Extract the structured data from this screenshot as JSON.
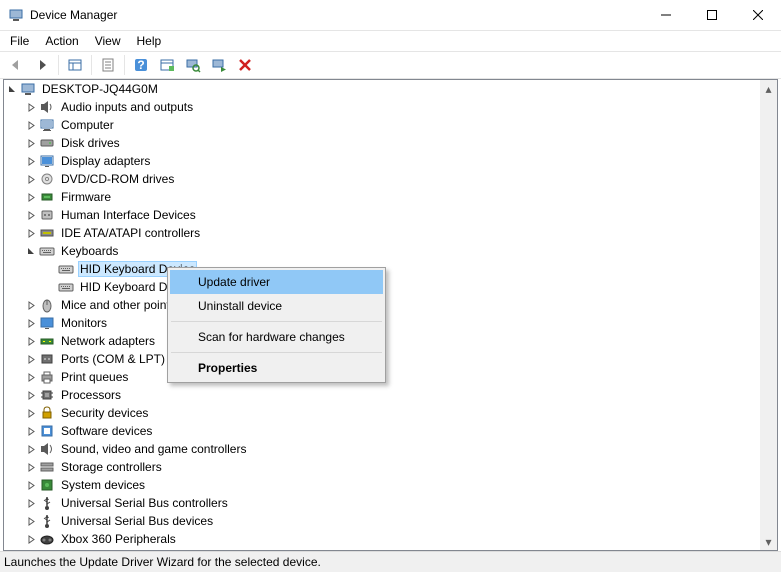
{
  "window": {
    "title": "Device Manager"
  },
  "menubar": {
    "items": [
      "File",
      "Action",
      "View",
      "Help"
    ]
  },
  "toolbar": {
    "items": [
      {
        "name": "back-icon",
        "sep_after": false
      },
      {
        "name": "forward-icon",
        "sep_after": true
      },
      {
        "name": "show-hidden-icon",
        "sep_after": true
      },
      {
        "name": "properties-icon",
        "sep_after": true
      },
      {
        "name": "help-icon",
        "sep_after": false
      },
      {
        "name": "update-driver-icon",
        "sep_after": false
      },
      {
        "name": "scan-hardware-icon",
        "sep_after": false
      },
      {
        "name": "enable-device-icon",
        "sep_after": false
      },
      {
        "name": "uninstall-device-icon",
        "sep_after": false
      }
    ]
  },
  "tree": {
    "root": {
      "label": "DESKTOP-JQ44G0M",
      "expanded": true
    },
    "categories": [
      {
        "label": "Audio inputs and outputs",
        "icon": "audio",
        "expanded": false
      },
      {
        "label": "Computer",
        "icon": "computer",
        "expanded": false
      },
      {
        "label": "Disk drives",
        "icon": "disk",
        "expanded": false
      },
      {
        "label": "Display adapters",
        "icon": "display",
        "expanded": false
      },
      {
        "label": "DVD/CD-ROM drives",
        "icon": "dvd",
        "expanded": false
      },
      {
        "label": "Firmware",
        "icon": "firmware",
        "expanded": false
      },
      {
        "label": "Human Interface Devices",
        "icon": "hid",
        "expanded": false
      },
      {
        "label": "IDE ATA/ATAPI controllers",
        "icon": "ide",
        "expanded": false
      },
      {
        "label": "Keyboards",
        "icon": "keyboard",
        "expanded": true,
        "children": [
          {
            "label": "HID Keyboard Device",
            "icon": "keyboard",
            "selected": true
          },
          {
            "label": "HID Keyboard Device",
            "icon": "keyboard"
          }
        ]
      },
      {
        "label": "Mice and other pointing devices",
        "icon": "mouse",
        "expanded": false
      },
      {
        "label": "Monitors",
        "icon": "monitor",
        "expanded": false
      },
      {
        "label": "Network adapters",
        "icon": "network",
        "expanded": false
      },
      {
        "label": "Ports (COM & LPT)",
        "icon": "ports",
        "expanded": false
      },
      {
        "label": "Print queues",
        "icon": "printer",
        "expanded": false
      },
      {
        "label": "Processors",
        "icon": "processor",
        "expanded": false
      },
      {
        "label": "Security devices",
        "icon": "security",
        "expanded": false
      },
      {
        "label": "Software devices",
        "icon": "software",
        "expanded": false
      },
      {
        "label": "Sound, video and game controllers",
        "icon": "sound",
        "expanded": false
      },
      {
        "label": "Storage controllers",
        "icon": "storage",
        "expanded": false
      },
      {
        "label": "System devices",
        "icon": "system",
        "expanded": false
      },
      {
        "label": "Universal Serial Bus controllers",
        "icon": "usb",
        "expanded": false
      },
      {
        "label": "Universal Serial Bus devices",
        "icon": "usb",
        "expanded": false
      },
      {
        "label": "Xbox 360 Peripherals",
        "icon": "xbox",
        "expanded": false
      }
    ]
  },
  "context_menu": {
    "items": [
      {
        "label": "Update driver",
        "hover": true
      },
      {
        "label": "Uninstall device"
      },
      {
        "sep": true
      },
      {
        "label": "Scan for hardware changes"
      },
      {
        "sep": true
      },
      {
        "label": "Properties",
        "bold": true
      }
    ]
  },
  "statusbar": {
    "text": "Launches the Update Driver Wizard for the selected device."
  }
}
